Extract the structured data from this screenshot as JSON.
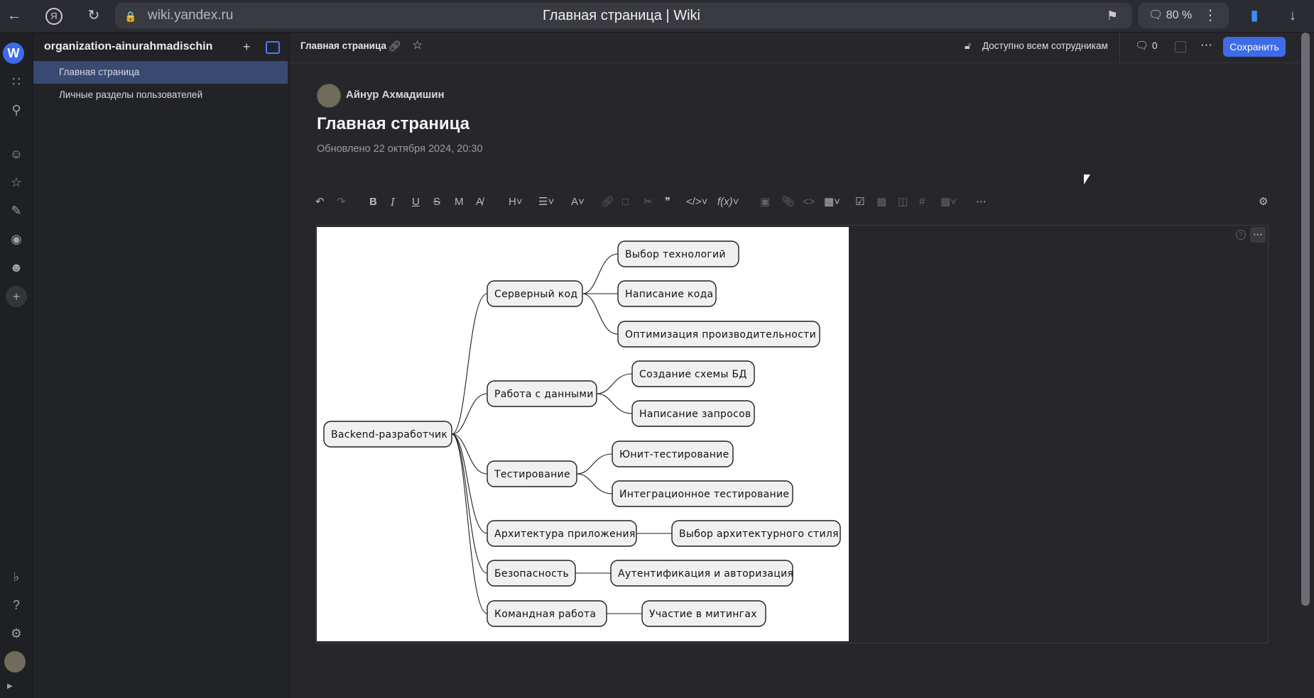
{
  "browser": {
    "url": "wiki.yandex.ru",
    "tab_title": "Главная страница | Wiki",
    "zoom": "80 %"
  },
  "workspace": {
    "badge": "W",
    "org_name": "organization-ainurahmadischin"
  },
  "sidebar": {
    "items": [
      {
        "label": "Главная страница"
      },
      {
        "label": "Личные разделы пользователей"
      }
    ]
  },
  "header": {
    "breadcrumb": "Главная страница",
    "access": "Доступно всем сотрудникам",
    "comments_count": "0",
    "save_label": "Сохранить"
  },
  "document": {
    "author": "Айнур Ахмадишин",
    "title": "Главная страница",
    "updated": "Обновлено 22 октября 2024, 20:30"
  },
  "toolbar": {
    "heading": "H",
    "text_color": "A",
    "formula": "f(x)"
  },
  "mindmap": {
    "root": "Backend-разработчик",
    "branches": [
      {
        "label": "Серверный код",
        "children": [
          "Выбор технологий",
          "Написание кода",
          "Оптимизация производительности"
        ]
      },
      {
        "label": "Работа с данными",
        "children": [
          "Создание схемы БД",
          "Написание запросов"
        ]
      },
      {
        "label": "Тестирование",
        "children": [
          "Юнит-тестирование",
          "Интеграционное тестирование"
        ]
      },
      {
        "label": "Архитектура приложения",
        "children": [
          "Выбор архитектурного стиля"
        ]
      },
      {
        "label": "Безопасность",
        "children": [
          "Аутентификация и авторизация"
        ]
      },
      {
        "label": "Командная работа",
        "children": [
          "Участие в митингах"
        ]
      }
    ]
  },
  "colors": {
    "accent": "#3e6be8",
    "sidebar_active": "#384a72",
    "background": "#27272b"
  }
}
